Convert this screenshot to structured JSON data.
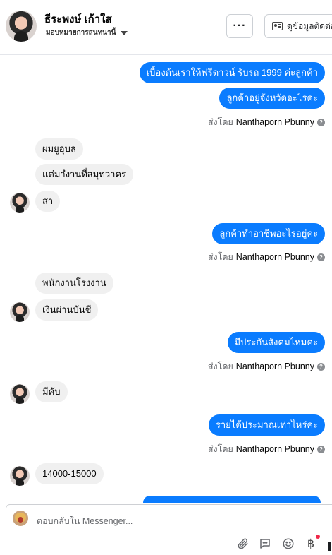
{
  "header": {
    "contact_name": "ธีระพงษ์ เก้าใส",
    "assign_label": "มอบหมายการสนทนานี้",
    "more_label": "···",
    "view_info_label": "ดูข้อมูลติดต่อ"
  },
  "messages": {
    "m1": "เบื้องต้นเราให้ฟรีดาวน์ รับรถ 1999 ค่ะลูกค้า",
    "m2": "ลูกค้าอยู่จังหวัดอะไรคะ",
    "m3": "ผมยูอุบล",
    "m4": "แต่มาํงานที่สมุทวาคร",
    "m5": "สา",
    "m6": "ลูกค้าทำอาชีพอะไรอยู่คะ",
    "m7": "พนักงานโรงงาน",
    "m8": "เงินผ่านบันชี",
    "m9": "มีประกันสังคมไหมคะ",
    "m10": "มีคับ",
    "m11": "รายได้ประมาณเท่าไหร่คะ",
    "m12": "14000-15000"
  },
  "sent_by": {
    "prefix": "ส่งโดย",
    "name": "Nanthaporn Pbunny",
    "help_icon": "?"
  },
  "reply": {
    "placeholder": "ตอบกลับใน Messenger..."
  },
  "icons": {
    "attach": "paperclip-icon",
    "saved_replies": "chat-bubble-icon",
    "emoji": "smiley-icon",
    "payment": "฿"
  },
  "colors": {
    "outgoing_bubble": "#0a7cff",
    "incoming_bubble": "#f0f0f0",
    "notification_dot": "#f02849"
  }
}
